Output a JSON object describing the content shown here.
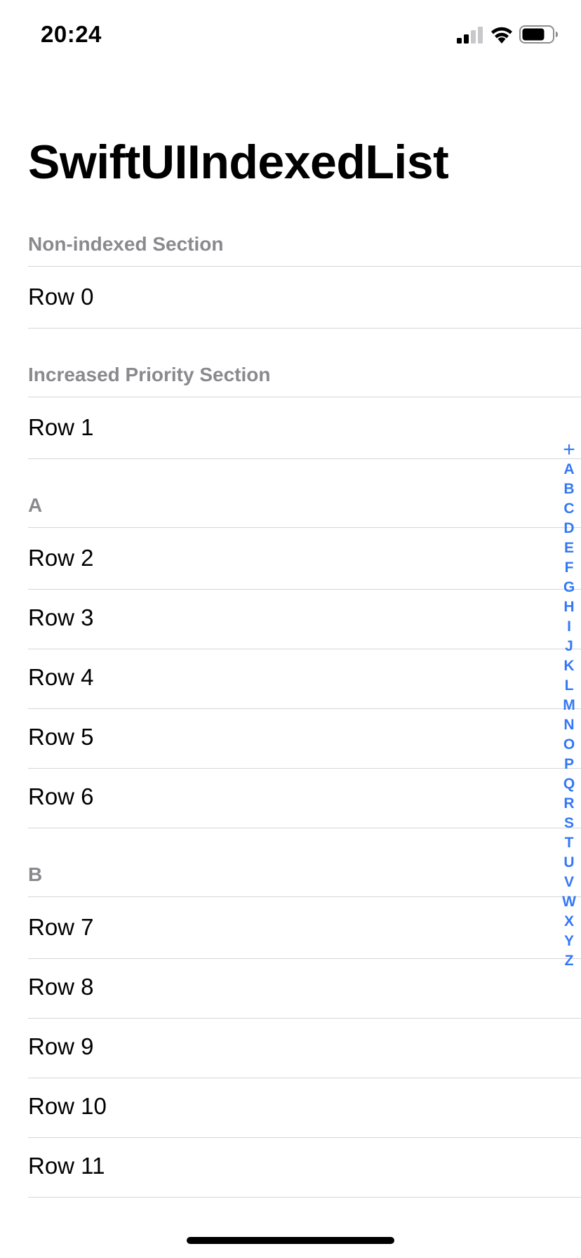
{
  "status_bar": {
    "time": "20:24",
    "icons": [
      "cellular-signal-icon",
      "wifi-icon",
      "battery-icon"
    ]
  },
  "title": "SwiftUIIndexedList",
  "sections": [
    {
      "header": "Non-indexed Section",
      "rows": [
        "Row 0"
      ]
    },
    {
      "header": "Increased Priority Section",
      "rows": [
        "Row 1"
      ]
    },
    {
      "header": "A",
      "rows": [
        "Row 2",
        "Row 3",
        "Row 4",
        "Row 5",
        "Row 6"
      ]
    },
    {
      "header": "B",
      "rows": [
        "Row 7",
        "Row 8",
        "Row 9",
        "Row 10",
        "Row 11"
      ]
    }
  ],
  "index": [
    "+",
    "A",
    "B",
    "C",
    "D",
    "E",
    "F",
    "G",
    "H",
    "I",
    "J",
    "K",
    "L",
    "M",
    "N",
    "O",
    "P",
    "Q",
    "R",
    "S",
    "T",
    "U",
    "V",
    "W",
    "X",
    "Y",
    "Z"
  ],
  "colors": {
    "accent": "#3478f6",
    "section_header": "#8a8a8e",
    "separator": "#d6d6da"
  }
}
